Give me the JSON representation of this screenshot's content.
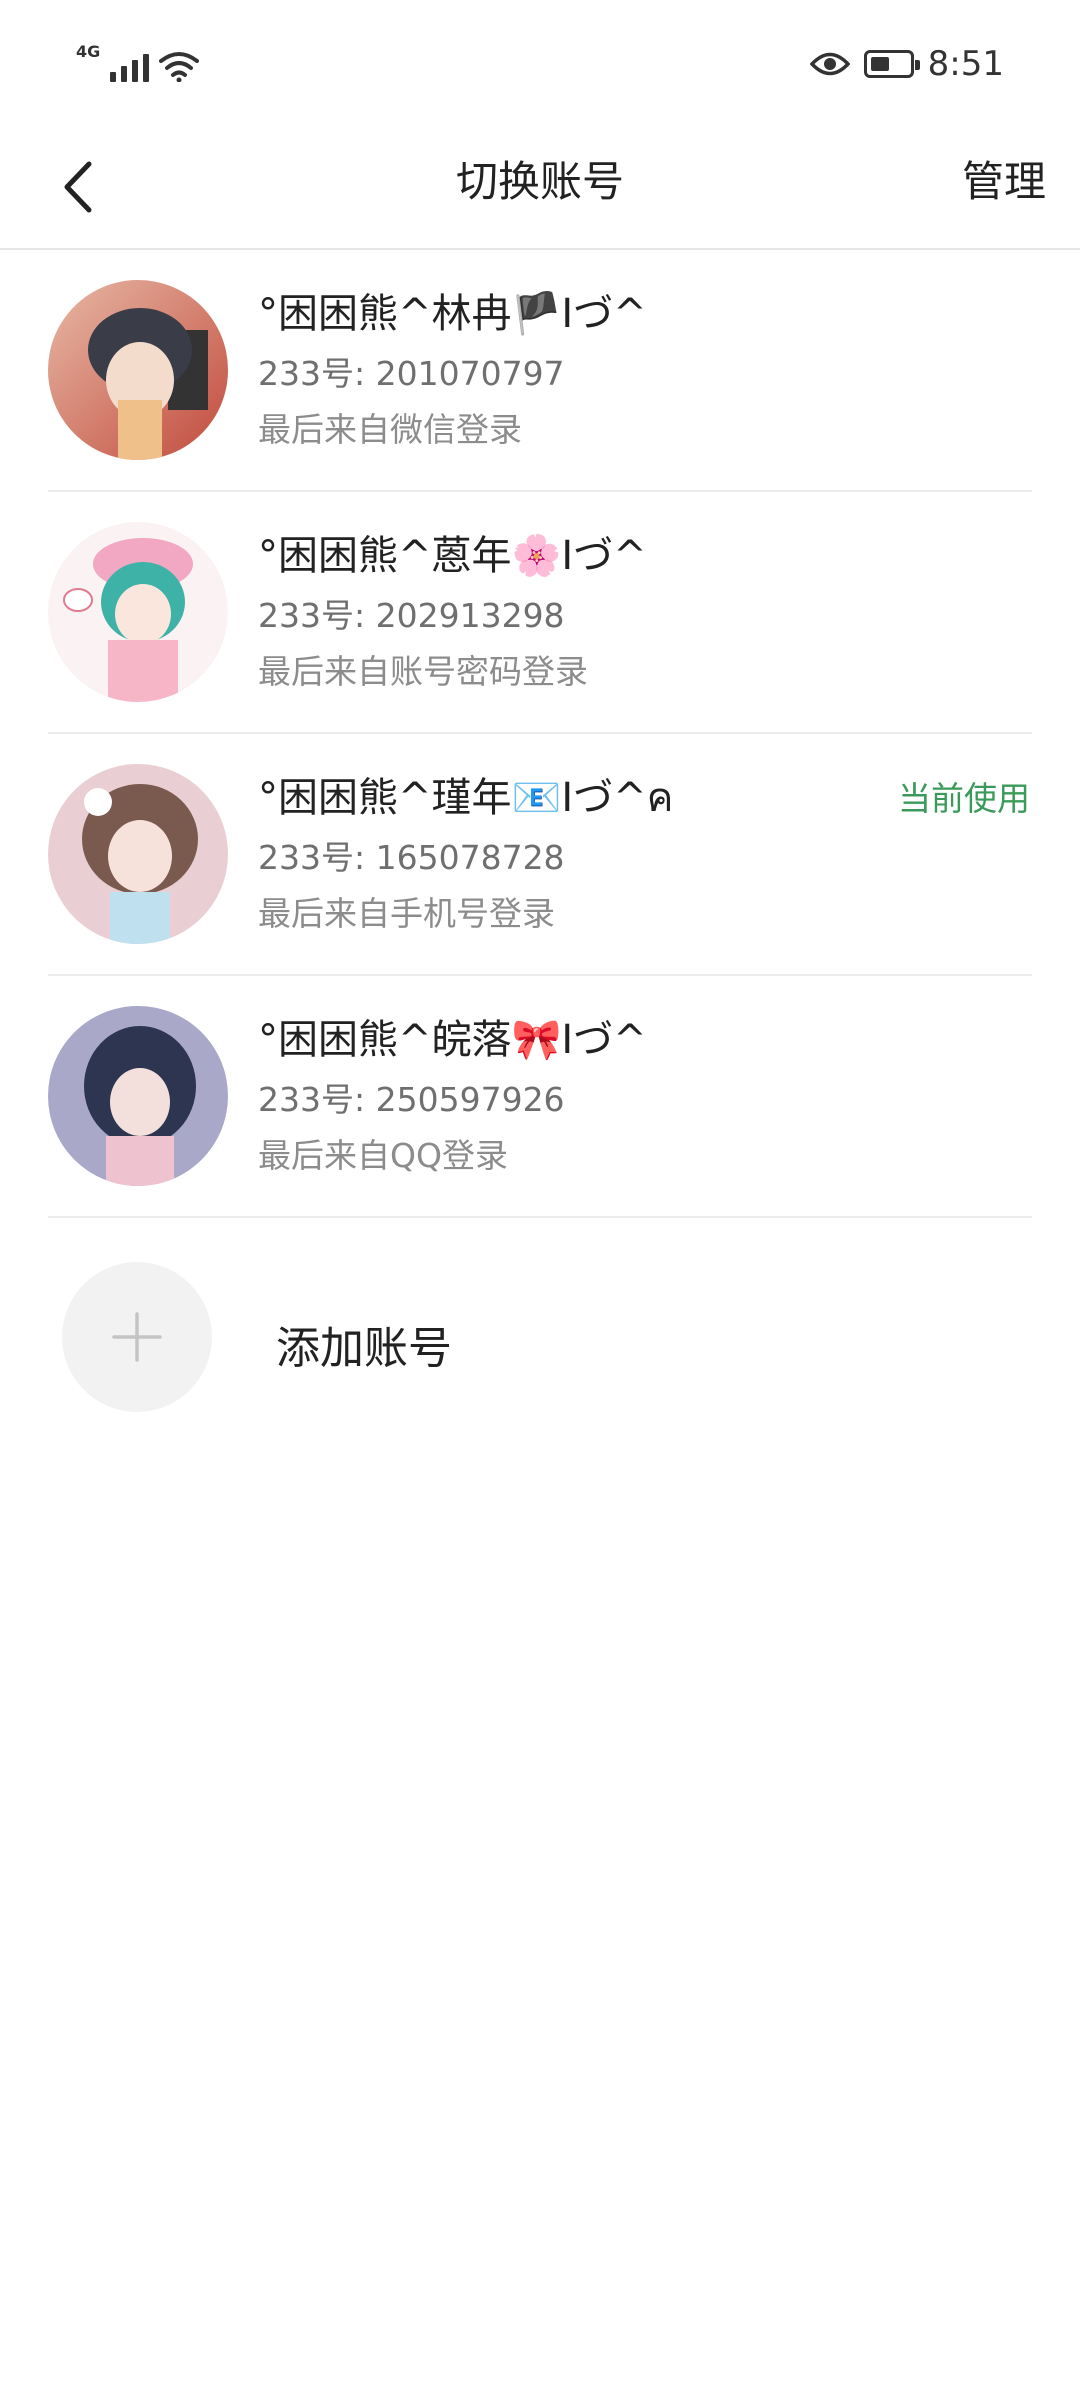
{
  "status_bar": {
    "network": "4G",
    "time": "8:51"
  },
  "header": {
    "title": "切换账号",
    "manage_label": "管理"
  },
  "accounts": [
    {
      "name": "°困困熊^林冉🏴Iづ^",
      "uid": "233号: 201070797",
      "login": "最后来自微信登录",
      "current": ""
    },
    {
      "name": "°困困熊^蒽年🌸Iづ^",
      "uid": "233号: 202913298",
      "login": "最后来自账号密码登录",
      "current": ""
    },
    {
      "name": "°困困熊^瑾年📧Iづ^ค",
      "uid": "233号: 165078728",
      "login": "最后来自手机号登录",
      "current": "当前使用"
    },
    {
      "name": "°困困熊^皖落🎀Iづ^",
      "uid": "233号: 250597926",
      "login": "最后来自QQ登录",
      "current": ""
    }
  ],
  "add_account": {
    "label": "添加账号"
  },
  "icons": {
    "back": "chevron-left-icon",
    "add": "plus-icon",
    "eye": "eye-icon",
    "battery": "battery-icon",
    "wifi": "wifi-icon",
    "signal": "signal-icon"
  },
  "colors": {
    "current_tag": "#3a9a5a"
  }
}
